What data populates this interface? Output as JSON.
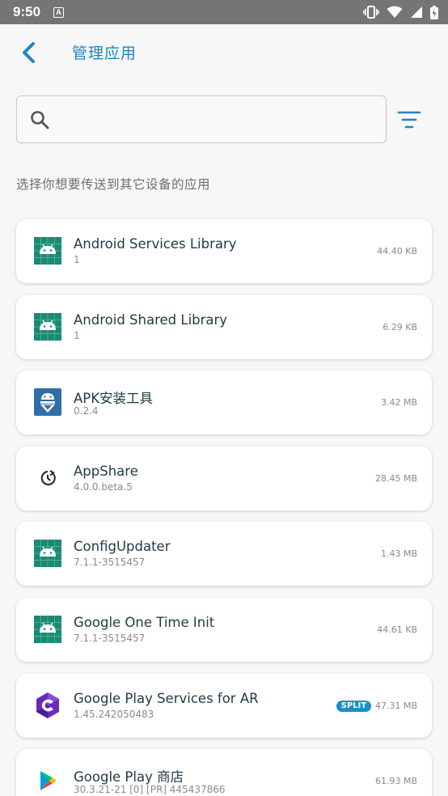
{
  "status_bar": {
    "time": "9:50",
    "notification": "A"
  },
  "header": {
    "title": "管理应用"
  },
  "search": {
    "value": "",
    "placeholder": ""
  },
  "subtitle": "选择你想要传送到其它设备的应用",
  "colors": {
    "accent": "#1e86c1",
    "android_icon": "#1a8a75",
    "split_badge": "#1a8fc7"
  },
  "apps": [
    {
      "name": "Android Services Library",
      "version": "1",
      "size": "44.40 KB",
      "icon": "android-icon"
    },
    {
      "name": "Android Shared Library",
      "version": "1",
      "size": "6.29 KB",
      "icon": "android-icon"
    },
    {
      "name": "APK安装工具",
      "version": "0.2.4",
      "size": "3.42 MB",
      "icon": "apk-installer-icon"
    },
    {
      "name": "AppShare",
      "version": "4.0.0.beta.5",
      "size": "28.45 MB",
      "icon": "appshare-icon"
    },
    {
      "name": "ConfigUpdater",
      "version": "7.1.1-3515457",
      "size": "1.43 MB",
      "icon": "android-icon"
    },
    {
      "name": "Google One Time Init",
      "version": "7.1.1-3515457",
      "size": "44.61 KB",
      "icon": "android-icon"
    },
    {
      "name": "Google Play Services for AR",
      "version": "1.45.242050483",
      "size": "47.31 MB",
      "icon": "arcore-icon",
      "badge": "SPLIT"
    },
    {
      "name": "Google Play 商店",
      "version": "30.3.21-21 [0] [PR] 445437866",
      "size": "61.93 MB",
      "icon": "play-store-icon"
    }
  ]
}
